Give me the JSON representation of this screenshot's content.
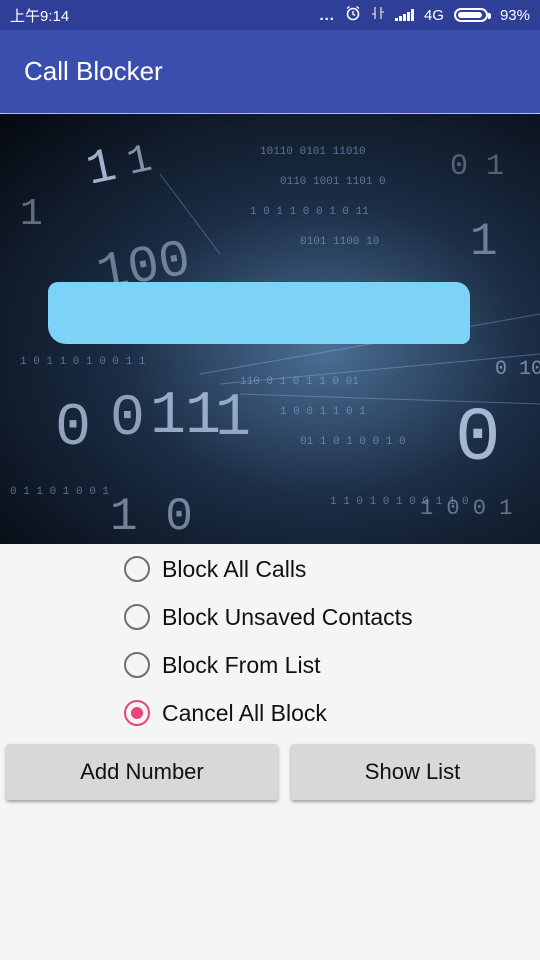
{
  "status_bar": {
    "time": "上午9:14",
    "dots": "...",
    "network": "4G",
    "battery": "93%",
    "battery_level": 0.93
  },
  "app_bar": {
    "title": "Call Blocker"
  },
  "options": [
    {
      "label": "Block All Calls",
      "checked": false
    },
    {
      "label": "Block Unsaved Contacts",
      "checked": false
    },
    {
      "label": "Block From List",
      "checked": false
    },
    {
      "label": "Cancel All Block",
      "checked": true
    }
  ],
  "buttons": {
    "add_number": "Add Number",
    "show_list": "Show List"
  },
  "colors": {
    "status_bar": "#2f3f98",
    "app_bar": "#3a4fad",
    "accent": "#e8447a",
    "redaction": "#7dd2f8",
    "button": "#d8d8d8"
  },
  "icons": [
    "alarm-icon",
    "mute-icon",
    "signal-icon",
    "battery-icon"
  ]
}
